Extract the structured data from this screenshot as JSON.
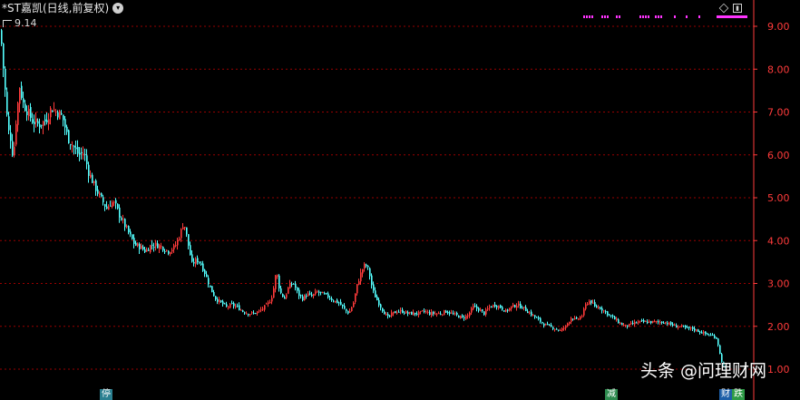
{
  "header": {
    "title": "*ST嘉凯(日线,前复权)",
    "peak_label": "9.14"
  },
  "events": {
    "suspend": "停",
    "reduce": "减",
    "fin": "财",
    "fall": "跌"
  },
  "watermark": "头条 @问理财网",
  "colors": {
    "background": "#000000",
    "up_candle": "#ff3b3b",
    "down_candle": "#54ffff",
    "grid": "#990000",
    "axis": "#ff3b3b",
    "signal_dots": "#ff33ff"
  },
  "chart_data": {
    "type": "candlestick",
    "title": "*ST嘉凯(日线,前复权)",
    "ylim": [
      0.9,
      9.5
    ],
    "yticks": [
      "1.00",
      "2.00",
      "3.00",
      "4.00",
      "5.00",
      "6.00",
      "7.00",
      "8.00",
      "9.00"
    ],
    "grid": true,
    "max_price": 9.14,
    "close_path": [
      [
        0,
        8.9
      ],
      [
        2,
        8.3
      ],
      [
        5,
        7.5
      ],
      [
        8,
        6.6
      ],
      [
        11,
        6.4
      ],
      [
        14,
        5.9
      ],
      [
        17,
        6.8
      ],
      [
        21,
        7.6
      ],
      [
        25,
        7.2
      ],
      [
        30,
        7.0
      ],
      [
        35,
        6.8
      ],
      [
        42,
        6.7
      ],
      [
        50,
        6.8
      ],
      [
        56,
        7.1
      ],
      [
        62,
        7.0
      ],
      [
        68,
        6.9
      ],
      [
        74,
        6.4
      ],
      [
        80,
        6.2
      ],
      [
        86,
        6.0
      ],
      [
        92,
        6.05
      ],
      [
        97,
        5.6
      ],
      [
        103,
        5.3
      ],
      [
        110,
        5.0
      ],
      [
        117,
        4.75
      ],
      [
        122,
        4.9
      ],
      [
        126,
        4.85
      ],
      [
        131,
        4.6
      ],
      [
        137,
        4.35
      ],
      [
        143,
        4.1
      ],
      [
        148,
        3.9
      ],
      [
        154,
        3.85
      ],
      [
        160,
        3.75
      ],
      [
        166,
        3.9
      ],
      [
        172,
        3.9
      ],
      [
        178,
        3.85
      ],
      [
        185,
        3.75
      ],
      [
        192,
        3.85
      ],
      [
        198,
        4.15
      ],
      [
        202,
        4.45
      ],
      [
        206,
        4.0
      ],
      [
        211,
        3.45
      ],
      [
        216,
        3.55
      ],
      [
        220,
        3.5
      ],
      [
        226,
        3.2
      ],
      [
        231,
        2.9
      ],
      [
        237,
        2.65
      ],
      [
        243,
        2.55
      ],
      [
        249,
        2.45
      ],
      [
        255,
        2.5
      ],
      [
        261,
        2.45
      ],
      [
        267,
        2.35
      ],
      [
        273,
        2.3
      ],
      [
        279,
        2.3
      ],
      [
        285,
        2.35
      ],
      [
        291,
        2.45
      ],
      [
        296,
        2.55
      ],
      [
        300,
        2.75
      ],
      [
        304,
        3.3
      ],
      [
        308,
        2.8
      ],
      [
        313,
        2.65
      ],
      [
        318,
        2.95
      ],
      [
        323,
        3.0
      ],
      [
        328,
        2.75
      ],
      [
        333,
        2.65
      ],
      [
        338,
        2.75
      ],
      [
        343,
        2.7
      ],
      [
        349,
        2.8
      ],
      [
        355,
        2.75
      ],
      [
        361,
        2.7
      ],
      [
        367,
        2.6
      ],
      [
        373,
        2.55
      ],
      [
        379,
        2.4
      ],
      [
        384,
        2.3
      ],
      [
        389,
        2.55
      ],
      [
        393,
        2.95
      ],
      [
        398,
        3.3
      ],
      [
        402,
        3.45
      ],
      [
        406,
        3.3
      ],
      [
        410,
        2.85
      ],
      [
        414,
        2.65
      ],
      [
        418,
        2.5
      ],
      [
        422,
        2.35
      ],
      [
        427,
        2.2
      ],
      [
        432,
        2.3
      ],
      [
        437,
        2.35
      ],
      [
        443,
        2.35
      ],
      [
        449,
        2.3
      ],
      [
        455,
        2.3
      ],
      [
        461,
        2.3
      ],
      [
        467,
        2.35
      ],
      [
        473,
        2.3
      ],
      [
        479,
        2.3
      ],
      [
        485,
        2.3
      ],
      [
        491,
        2.35
      ],
      [
        497,
        2.3
      ],
      [
        503,
        2.25
      ],
      [
        509,
        2.2
      ],
      [
        515,
        2.25
      ],
      [
        521,
        2.45
      ],
      [
        527,
        2.4
      ],
      [
        533,
        2.3
      ],
      [
        539,
        2.45
      ],
      [
        545,
        2.5
      ],
      [
        551,
        2.45
      ],
      [
        557,
        2.35
      ],
      [
        563,
        2.45
      ],
      [
        569,
        2.5
      ],
      [
        575,
        2.45
      ],
      [
        581,
        2.35
      ],
      [
        587,
        2.25
      ],
      [
        593,
        2.15
      ],
      [
        599,
        2.05
      ],
      [
        605,
        2.0
      ],
      [
        611,
        1.95
      ],
      [
        617,
        1.9
      ],
      [
        623,
        2.0
      ],
      [
        629,
        2.2
      ],
      [
        635,
        2.15
      ],
      [
        641,
        2.25
      ],
      [
        646,
        2.55
      ],
      [
        650,
        2.6
      ],
      [
        655,
        2.45
      ],
      [
        660,
        2.45
      ],
      [
        666,
        2.35
      ],
      [
        672,
        2.25
      ],
      [
        678,
        2.15
      ],
      [
        684,
        2.05
      ],
      [
        690,
        2.0
      ],
      [
        696,
        2.05
      ],
      [
        702,
        2.1
      ],
      [
        708,
        2.1
      ],
      [
        714,
        2.1
      ],
      [
        720,
        2.1
      ],
      [
        726,
        2.1
      ],
      [
        732,
        2.1
      ],
      [
        738,
        2.05
      ],
      [
        744,
        2.0
      ],
      [
        750,
        2.0
      ],
      [
        756,
        1.95
      ],
      [
        762,
        1.95
      ],
      [
        768,
        1.9
      ],
      [
        774,
        1.85
      ],
      [
        780,
        1.8
      ],
      [
        786,
        1.78
      ],
      [
        790,
        1.7
      ],
      [
        793,
        1.35
      ],
      [
        796,
        1.1
      ],
      [
        799,
        1.0
      ]
    ]
  }
}
